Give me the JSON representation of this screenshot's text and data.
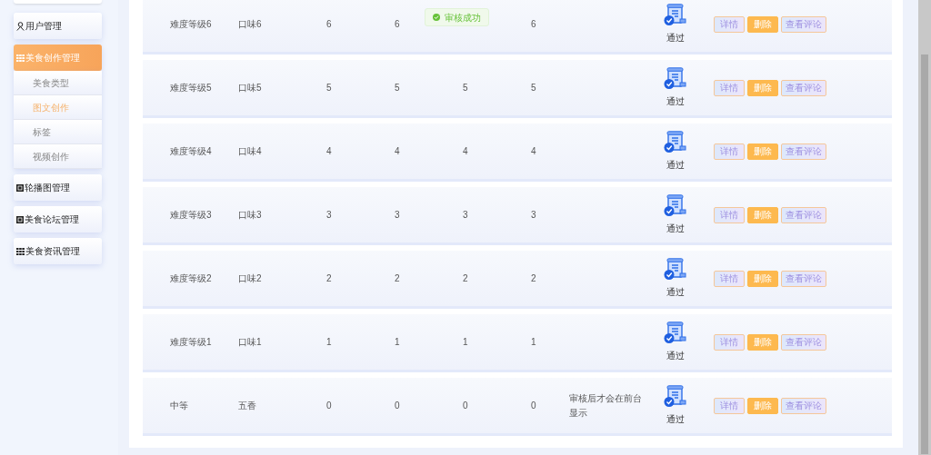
{
  "sidebar": {
    "items": [
      {
        "label": "用户管理",
        "selected": false
      },
      {
        "label": "美食创作管理",
        "selected": true,
        "children": [
          {
            "label": "美食类型",
            "selected": false
          },
          {
            "label": "图文创作",
            "selected": true
          },
          {
            "label": "标签",
            "selected": false
          },
          {
            "label": "视频创作",
            "selected": false
          }
        ]
      },
      {
        "label": "轮播图管理",
        "selected": false
      },
      {
        "label": "美食论坛管理",
        "selected": false
      },
      {
        "label": "美食资讯管理",
        "selected": false
      }
    ]
  },
  "toast": {
    "text": "审核成功"
  },
  "table": {
    "rows": [
      {
        "cells": [
          "难度等级6",
          "口味6",
          "6",
          "6",
          null,
          "6"
        ],
        "remark": null,
        "status": "通过",
        "actions": [
          "详情",
          "删除",
          "查看评论"
        ]
      },
      {
        "cells": [
          "难度等级5",
          "口味5",
          "5",
          "5",
          "5",
          "5"
        ],
        "remark": null,
        "status": "通过",
        "actions": [
          "详情",
          "删除",
          "查看评论"
        ]
      },
      {
        "cells": [
          "难度等级4",
          "口味4",
          "4",
          "4",
          "4",
          "4"
        ],
        "remark": null,
        "status": "通过",
        "actions": [
          "详情",
          "删除",
          "查看评论"
        ]
      },
      {
        "cells": [
          "难度等级3",
          "口味3",
          "3",
          "3",
          "3",
          "3"
        ],
        "remark": null,
        "status": "通过",
        "actions": [
          "详情",
          "删除",
          "查看评论"
        ]
      },
      {
        "cells": [
          "难度等级2",
          "口味2",
          "2",
          "2",
          "2",
          "2"
        ],
        "remark": null,
        "status": "通过",
        "actions": [
          "详情",
          "删除",
          "查看评论"
        ]
      },
      {
        "cells": [
          "难度等级1",
          "口味1",
          "1",
          "1",
          "1",
          "1"
        ],
        "remark": null,
        "status": "通过",
        "actions": [
          "详情",
          "删除",
          "查看评论"
        ]
      },
      {
        "cells": [
          "中等",
          "五香",
          "0",
          "0",
          "0",
          "0"
        ],
        "remark": "审核后才会在前台显示",
        "status": "通过",
        "actions": [
          "详情",
          "删除",
          "查看评论"
        ]
      }
    ]
  }
}
